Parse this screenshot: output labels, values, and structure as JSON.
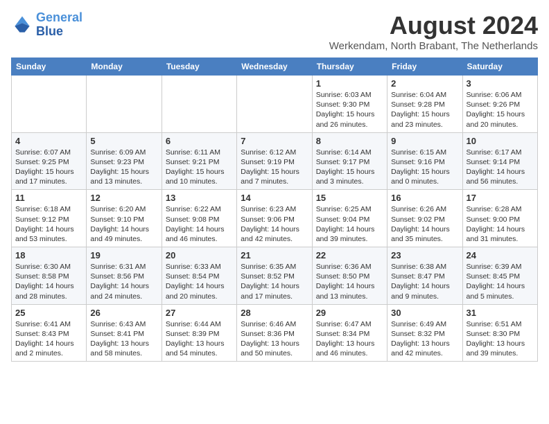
{
  "logo": {
    "line1": "General",
    "line2": "Blue"
  },
  "title": "August 2024",
  "subtitle": "Werkendam, North Brabant, The Netherlands",
  "headers": [
    "Sunday",
    "Monday",
    "Tuesday",
    "Wednesday",
    "Thursday",
    "Friday",
    "Saturday"
  ],
  "weeks": [
    [
      {
        "day": "",
        "detail": ""
      },
      {
        "day": "",
        "detail": ""
      },
      {
        "day": "",
        "detail": ""
      },
      {
        "day": "",
        "detail": ""
      },
      {
        "day": "1",
        "detail": "Sunrise: 6:03 AM\nSunset: 9:30 PM\nDaylight: 15 hours\nand 26 minutes."
      },
      {
        "day": "2",
        "detail": "Sunrise: 6:04 AM\nSunset: 9:28 PM\nDaylight: 15 hours\nand 23 minutes."
      },
      {
        "day": "3",
        "detail": "Sunrise: 6:06 AM\nSunset: 9:26 PM\nDaylight: 15 hours\nand 20 minutes."
      }
    ],
    [
      {
        "day": "4",
        "detail": "Sunrise: 6:07 AM\nSunset: 9:25 PM\nDaylight: 15 hours\nand 17 minutes."
      },
      {
        "day": "5",
        "detail": "Sunrise: 6:09 AM\nSunset: 9:23 PM\nDaylight: 15 hours\nand 13 minutes."
      },
      {
        "day": "6",
        "detail": "Sunrise: 6:11 AM\nSunset: 9:21 PM\nDaylight: 15 hours\nand 10 minutes."
      },
      {
        "day": "7",
        "detail": "Sunrise: 6:12 AM\nSunset: 9:19 PM\nDaylight: 15 hours\nand 7 minutes."
      },
      {
        "day": "8",
        "detail": "Sunrise: 6:14 AM\nSunset: 9:17 PM\nDaylight: 15 hours\nand 3 minutes."
      },
      {
        "day": "9",
        "detail": "Sunrise: 6:15 AM\nSunset: 9:16 PM\nDaylight: 15 hours\nand 0 minutes."
      },
      {
        "day": "10",
        "detail": "Sunrise: 6:17 AM\nSunset: 9:14 PM\nDaylight: 14 hours\nand 56 minutes."
      }
    ],
    [
      {
        "day": "11",
        "detail": "Sunrise: 6:18 AM\nSunset: 9:12 PM\nDaylight: 14 hours\nand 53 minutes."
      },
      {
        "day": "12",
        "detail": "Sunrise: 6:20 AM\nSunset: 9:10 PM\nDaylight: 14 hours\nand 49 minutes."
      },
      {
        "day": "13",
        "detail": "Sunrise: 6:22 AM\nSunset: 9:08 PM\nDaylight: 14 hours\nand 46 minutes."
      },
      {
        "day": "14",
        "detail": "Sunrise: 6:23 AM\nSunset: 9:06 PM\nDaylight: 14 hours\nand 42 minutes."
      },
      {
        "day": "15",
        "detail": "Sunrise: 6:25 AM\nSunset: 9:04 PM\nDaylight: 14 hours\nand 39 minutes."
      },
      {
        "day": "16",
        "detail": "Sunrise: 6:26 AM\nSunset: 9:02 PM\nDaylight: 14 hours\nand 35 minutes."
      },
      {
        "day": "17",
        "detail": "Sunrise: 6:28 AM\nSunset: 9:00 PM\nDaylight: 14 hours\nand 31 minutes."
      }
    ],
    [
      {
        "day": "18",
        "detail": "Sunrise: 6:30 AM\nSunset: 8:58 PM\nDaylight: 14 hours\nand 28 minutes."
      },
      {
        "day": "19",
        "detail": "Sunrise: 6:31 AM\nSunset: 8:56 PM\nDaylight: 14 hours\nand 24 minutes."
      },
      {
        "day": "20",
        "detail": "Sunrise: 6:33 AM\nSunset: 8:54 PM\nDaylight: 14 hours\nand 20 minutes."
      },
      {
        "day": "21",
        "detail": "Sunrise: 6:35 AM\nSunset: 8:52 PM\nDaylight: 14 hours\nand 17 minutes."
      },
      {
        "day": "22",
        "detail": "Sunrise: 6:36 AM\nSunset: 8:50 PM\nDaylight: 14 hours\nand 13 minutes."
      },
      {
        "day": "23",
        "detail": "Sunrise: 6:38 AM\nSunset: 8:47 PM\nDaylight: 14 hours\nand 9 minutes."
      },
      {
        "day": "24",
        "detail": "Sunrise: 6:39 AM\nSunset: 8:45 PM\nDaylight: 14 hours\nand 5 minutes."
      }
    ],
    [
      {
        "day": "25",
        "detail": "Sunrise: 6:41 AM\nSunset: 8:43 PM\nDaylight: 14 hours\nand 2 minutes."
      },
      {
        "day": "26",
        "detail": "Sunrise: 6:43 AM\nSunset: 8:41 PM\nDaylight: 13 hours\nand 58 minutes."
      },
      {
        "day": "27",
        "detail": "Sunrise: 6:44 AM\nSunset: 8:39 PM\nDaylight: 13 hours\nand 54 minutes."
      },
      {
        "day": "28",
        "detail": "Sunrise: 6:46 AM\nSunset: 8:36 PM\nDaylight: 13 hours\nand 50 minutes."
      },
      {
        "day": "29",
        "detail": "Sunrise: 6:47 AM\nSunset: 8:34 PM\nDaylight: 13 hours\nand 46 minutes."
      },
      {
        "day": "30",
        "detail": "Sunrise: 6:49 AM\nSunset: 8:32 PM\nDaylight: 13 hours\nand 42 minutes."
      },
      {
        "day": "31",
        "detail": "Sunrise: 6:51 AM\nSunset: 8:30 PM\nDaylight: 13 hours\nand 39 minutes."
      }
    ]
  ]
}
